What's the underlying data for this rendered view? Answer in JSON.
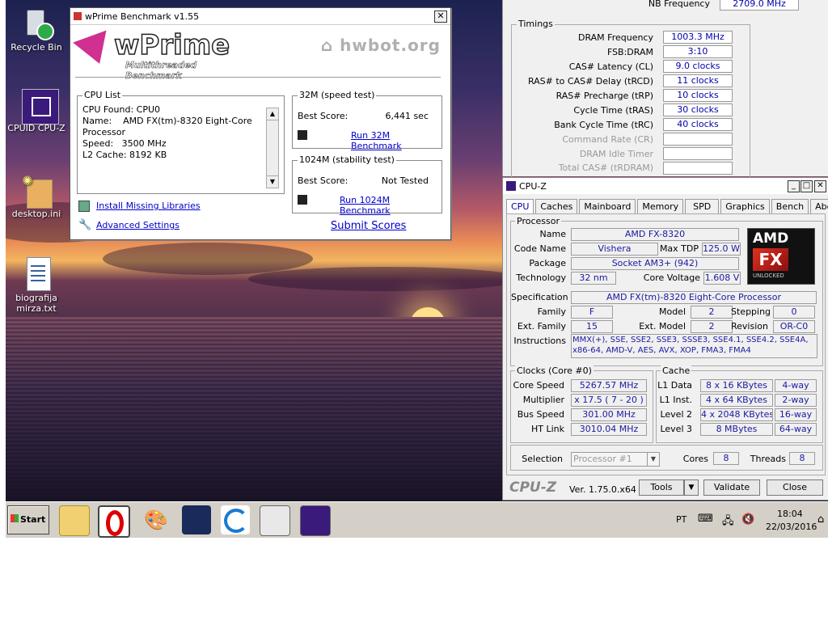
{
  "desktop": {
    "icons": [
      {
        "label": "Recycle Bin"
      },
      {
        "label": "CPUID CPU-Z"
      },
      {
        "label": "desktop.ini"
      },
      {
        "label": "biografija mirza.txt"
      }
    ]
  },
  "wprime": {
    "title": "wPrime Benchmark v1.55",
    "logo_main": "wPrime",
    "logo_sub": "Multithreaded Benchmark",
    "hwbot": "hwbot.org",
    "cpu_list_label": "CPU List",
    "cpu_lines": [
      "CPU Found: CPU0",
      "Name:    AMD FX(tm)-8320 Eight-Core",
      "Processor",
      "Speed:   3500 MHz",
      "L2 Cache: 8192 KB"
    ],
    "speed_label": "32M (speed test)",
    "speed_best_label": "Best Score:",
    "speed_best_value": "6,441 sec",
    "run32": "Run 32M Benchmark",
    "stab_label": "1024M (stability test)",
    "stab_best_label": "Best Score:",
    "stab_best_value": "Not Tested",
    "run1024": "Run 1024M Benchmark",
    "install": "Install Missing Libraries",
    "advanced": "Advanced Settings",
    "submit": "Submit Scores"
  },
  "timings": {
    "nb_label": "NB Frequency",
    "nb_value": "2709.0 MHz",
    "group_label": "Timings",
    "rows": [
      {
        "label": "DRAM Frequency",
        "value": "1003.3 MHz"
      },
      {
        "label": "FSB:DRAM",
        "value": "3:10"
      },
      {
        "label": "CAS# Latency (CL)",
        "value": "9.0 clocks"
      },
      {
        "label": "RAS# to CAS# Delay (tRCD)",
        "value": "11 clocks"
      },
      {
        "label": "RAS# Precharge (tRP)",
        "value": "10 clocks"
      },
      {
        "label": "Cycle Time (tRAS)",
        "value": "30 clocks"
      },
      {
        "label": "Bank Cycle Time (tRC)",
        "value": "40 clocks"
      },
      {
        "label": "Command Rate (CR)",
        "value": ""
      },
      {
        "label": "DRAM Idle Timer",
        "value": ""
      },
      {
        "label": "Total CAS# (tRDRAM)",
        "value": ""
      }
    ]
  },
  "cpuz": {
    "title": "CPU-Z",
    "tabs": [
      "CPU",
      "Caches",
      "Mainboard",
      "Memory",
      "SPD",
      "Graphics",
      "Bench",
      "About"
    ],
    "processor_label": "Processor",
    "name_label": "Name",
    "name": "AMD FX-8320",
    "codename_label": "Code Name",
    "codename": "Vishera",
    "tdp_label": "Max TDP",
    "tdp": "125.0 W",
    "package_label": "Package",
    "package": "Socket AM3+ (942)",
    "tech_label": "Technology",
    "tech": "32 nm",
    "voltage_label": "Core Voltage",
    "voltage": "1.608 V",
    "spec_label": "Specification",
    "spec": "AMD FX(tm)-8320 Eight-Core Processor",
    "family_label": "Family",
    "family": "F",
    "model_label": "Model",
    "model": "2",
    "stepping_label": "Stepping",
    "stepping": "0",
    "extfamily_label": "Ext. Family",
    "extfamily": "15",
    "extmodel_label": "Ext. Model",
    "extmodel": "2",
    "revision_label": "Revision",
    "revision": "OR-C0",
    "instr_label": "Instructions",
    "instr_1": "MMX(+), SSE, SSE2, SSE3, SSSE3, SSE4.1, SSE4.2, SSE4A,",
    "instr_2": "x86-64, AMD-V, AES, AVX, XOP, FMA3, FMA4",
    "clocks_label": "Clocks (Core #0)",
    "corespeed_label": "Core Speed",
    "corespeed": "5267.57 MHz",
    "mult_label": "Multiplier",
    "mult": "x 17.5 ( 7 - 20 )",
    "bus_label": "Bus Speed",
    "bus": "301.00 MHz",
    "ht_label": "HT Link",
    "ht": "3010.04 MHz",
    "cache_label": "Cache",
    "l1d_label": "L1 Data",
    "l1d": "8 x 16 KBytes",
    "l1d_way": "4-way",
    "l1i_label": "L1 Inst.",
    "l1i": "4 x 64 KBytes",
    "l1i_way": "2-way",
    "l2_label": "Level 2",
    "l2": "4 x 2048 KBytes",
    "l2_way": "16-way",
    "l3_label": "Level 3",
    "l3": "8 MBytes",
    "l3_way": "64-way",
    "selection_label": "Selection",
    "selection": "Processor #1",
    "cores_label": "Cores",
    "cores": "8",
    "threads_label": "Threads",
    "threads": "8",
    "brand": "CPU-Z",
    "version": "Ver. 1.75.0.x64",
    "tools": "Tools",
    "validate": "Validate",
    "close": "Close",
    "amd_text": "AMD",
    "fx_text": "FX",
    "unlocked": "UNLOCKED"
  },
  "taskbar": {
    "start": "Start",
    "lang": "PT",
    "time": "18:04",
    "date": "22/03/2016"
  }
}
